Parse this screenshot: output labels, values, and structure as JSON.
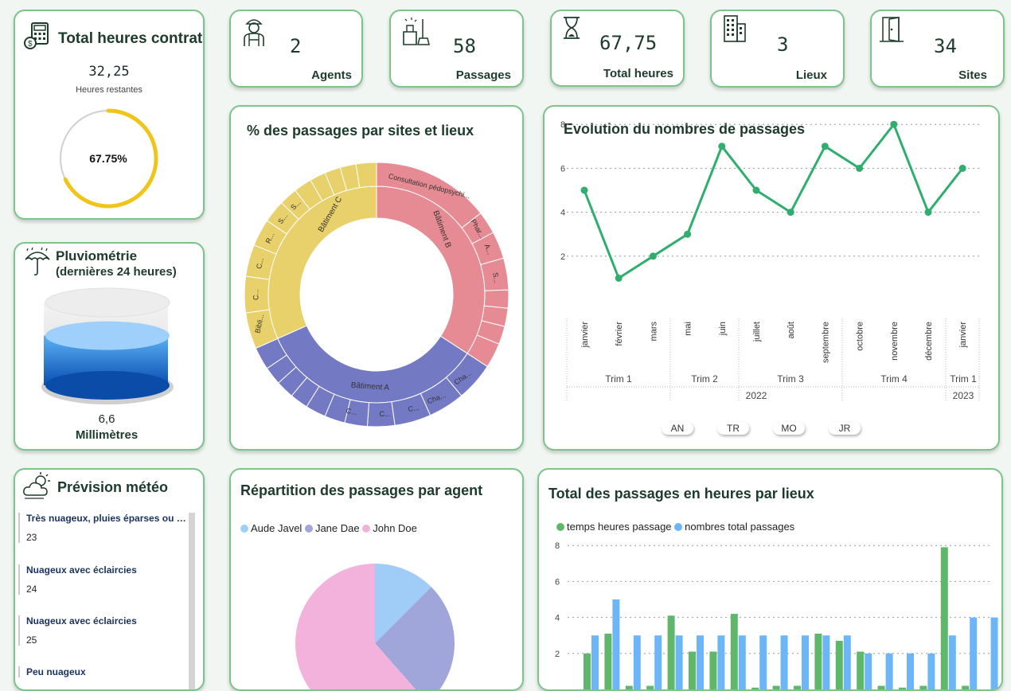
{
  "contract": {
    "title": "Total heures contrat",
    "remaining_value": "32,25",
    "remaining_label": "Heures restantes",
    "gauge_pct": "67.75%",
    "gauge_fraction": 0.6775
  },
  "rain": {
    "title_line1": "Pluviométrie",
    "title_line2": "(dernières  24 heures)",
    "value": "6,6",
    "unit": "Millimètres",
    "fill_fraction": 0.6
  },
  "kpis": [
    {
      "value": "2",
      "label": "Agents",
      "icon": "agent-icon"
    },
    {
      "value": "58",
      "label": "Passages",
      "icon": "cleaning-icon"
    },
    {
      "value": "67,75",
      "label": "Total heures",
      "icon": "hourglass-icon"
    },
    {
      "value": "3",
      "label": "Lieux",
      "icon": "building-icon"
    },
    {
      "value": "34",
      "label": "Sites",
      "icon": "door-icon"
    }
  ],
  "sunburst": {
    "title": "% des passages par sites et lieux",
    "inner": [
      {
        "label": "Bâtiment B",
        "color": "#e68b93"
      },
      {
        "label": "Bâtiment A",
        "color": "#7479c4"
      },
      {
        "label": "Bâtiment C",
        "color": "#e8d06a"
      }
    ],
    "outer_labels": [
      "Consultation pédopsychi...",
      "Phar...",
      "A...",
      "S...",
      "Cha...",
      "Cha...",
      "C...",
      "C...",
      "C...",
      "Bibli...",
      "C...",
      "C...",
      "R...",
      "S...",
      "S..."
    ]
  },
  "evolution": {
    "title": "Evolution du nombres de passages",
    "months": [
      "janvier",
      "février",
      "mars",
      "mai",
      "juin",
      "juillet",
      "août",
      "septembre",
      "octobre",
      "novembre",
      "décembre",
      "janvier"
    ],
    "values": [
      5,
      1,
      2,
      3,
      7,
      5,
      4,
      7,
      6,
      8,
      4,
      6
    ],
    "yticks": [
      "8",
      "6",
      "4",
      "2"
    ],
    "quarters": [
      "Trim 1",
      "Trim 2",
      "Trim 3",
      "Trim 4",
      "Trim 1"
    ],
    "years": [
      "2022",
      "2023"
    ],
    "buttons": [
      "AN",
      "TR",
      "MO",
      "JR"
    ],
    "color": "#2fae6e"
  },
  "weather": {
    "title": "Prévision météo",
    "items": [
      {
        "cond": "Très nuageux, pluies éparses ou aver...",
        "temp": "23"
      },
      {
        "cond": "Nuageux avec éclaircies",
        "temp": "24"
      },
      {
        "cond": "Nuageux avec éclaircies",
        "temp": "25"
      },
      {
        "cond": "Peu nuageux",
        "temp": ""
      }
    ]
  },
  "pie": {
    "title": "Répartition des passages par agent",
    "legend": [
      {
        "name": "Aude Javel",
        "color": "#a0cdf8"
      },
      {
        "name": "Jane Dae",
        "color": "#a0a6da"
      },
      {
        "name": "John Doe",
        "color": "#f2b2dc"
      }
    ],
    "values": [
      0.125,
      0.26,
      0.615
    ]
  },
  "bars": {
    "title": "Total des passages en heures par lieux",
    "legend": [
      {
        "name": "temps heures passage",
        "color": "#5fb86a"
      },
      {
        "name": "nombres total passages",
        "color": "#6cb6f8"
      }
    ],
    "yticks": [
      "8",
      "6",
      "4",
      "2"
    ],
    "hours": [
      2,
      3.1,
      0.2,
      0.2,
      4.1,
      2.1,
      2.1,
      4.2,
      0.1,
      0.2,
      0.2,
      3.1,
      2.7,
      2.1,
      0.2,
      0.1,
      0.2,
      7.9,
      0.2
    ],
    "passages": [
      3,
      5,
      3,
      3,
      3,
      3,
      3,
      3,
      3,
      3,
      3,
      3,
      3,
      2,
      2,
      2,
      2,
      3,
      4,
      4
    ]
  }
}
